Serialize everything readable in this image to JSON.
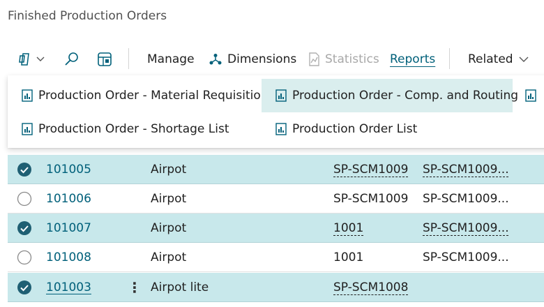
{
  "page": {
    "title": "Finished Production Orders"
  },
  "toolbar": {
    "manage_label": "Manage",
    "dimensions_label": "Dimensions",
    "statistics_label": "Statistics",
    "reports_label": "Reports",
    "related_label": "Related",
    "icons": [
      "views-icon",
      "search-icon",
      "analysis-icon",
      "dimensions-icon",
      "statistics-icon",
      "chevron-down-icon"
    ]
  },
  "reports_menu": {
    "items": [
      "Production Order - Material Requisition",
      "Production Order - Comp. and Routing",
      "Production Order - Shortage List",
      "Production Order List"
    ],
    "hovered_item": "Production Order - Comp. and Routing"
  },
  "rows": [
    {
      "no": "101005",
      "description": "Airpot",
      "source_no": "SP-SCM1009",
      "routing_no": "SP-SCM1009...",
      "selected": true
    },
    {
      "no": "101006",
      "description": "Airpot",
      "source_no": "SP-SCM1009",
      "routing_no": "SP-SCM1009...",
      "selected": false
    },
    {
      "no": "101007",
      "description": "Airpot",
      "source_no": "1001",
      "routing_no": "SP-SCM1009...",
      "selected": true
    },
    {
      "no": "101008",
      "description": "Airpot",
      "source_no": "1001",
      "routing_no": "SP-SCM1009...",
      "selected": false
    },
    {
      "no": "101003",
      "description": "Airpot lite",
      "source_no": "SP-SCM1008",
      "routing_no": "",
      "selected": true
    }
  ],
  "colors": {
    "accent": "#00607a",
    "selected_row": "#c8e8eb",
    "menu_hover": "#daeeee",
    "checkbox_checked": "#1f5f73"
  }
}
